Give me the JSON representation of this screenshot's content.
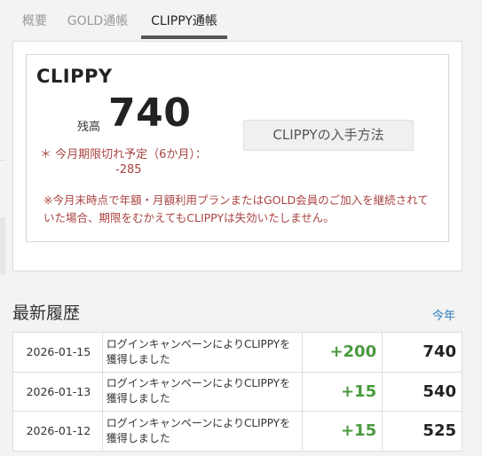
{
  "tabs": [
    {
      "label": "概要"
    },
    {
      "label": "GOLD通帳"
    },
    {
      "label": "CLIPPY通帳"
    }
  ],
  "summary": {
    "brand": "CLIPPY",
    "balance_label": "残高",
    "balance": "740",
    "expire_label": "＊ 今月期限切れ予定（6か月）：",
    "expire_value": "-285",
    "howto_button": "CLIPPYの入手方法",
    "notice": "※今月末時点で年額・月額利用プランまたはGOLD会員のご加入を継続されていた場合、期限をむかえてもCLIPPYは失効いたしません。"
  },
  "history": {
    "title": "最新履歴",
    "year_link": "今年",
    "rows": [
      {
        "date": "2026-01-15",
        "description": "ログインキャンペーンによりCLIPPYを獲得しました",
        "delta": "+200",
        "balance": "740"
      },
      {
        "date": "2026-01-13",
        "description": "ログインキャンペーンによりCLIPPYを獲得しました",
        "delta": "+15",
        "balance": "540"
      },
      {
        "date": "2026-01-12",
        "description": "ログインキャンペーンによりCLIPPYを獲得しました",
        "delta": "+15",
        "balance": "525"
      }
    ]
  },
  "colors": {
    "accent_positive": "#4a9a3e",
    "warning_text": "#a94442",
    "link": "#2a7ab8"
  }
}
